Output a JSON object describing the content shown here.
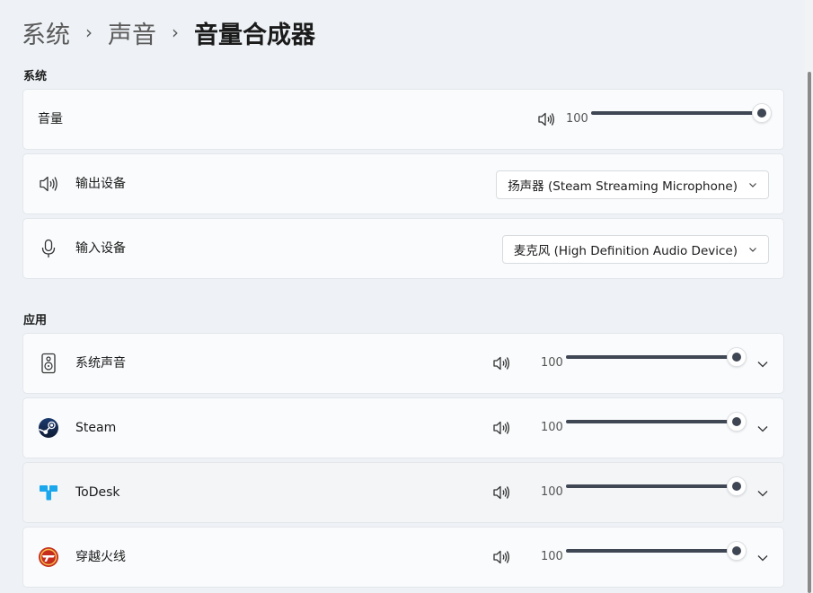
{
  "breadcrumb": {
    "items": [
      "系统",
      "声音"
    ],
    "separator": "›",
    "current": "音量合成器"
  },
  "system_section": {
    "label": "系统",
    "volume": {
      "label": "音量",
      "value": "100",
      "level": 1.0
    },
    "output": {
      "label": "输出设备",
      "selected": "扬声器 (Steam Streaming Microphone)"
    },
    "input": {
      "label": "输入设备",
      "selected": "麦克风 (High Definition Audio Device)"
    }
  },
  "apps_section": {
    "label": "应用",
    "apps": [
      {
        "name": "系统声音",
        "value": "100",
        "level": 1.0,
        "icon": "system-sounds-icon"
      },
      {
        "name": "Steam",
        "value": "100",
        "level": 1.0,
        "icon": "steam-icon"
      },
      {
        "name": "ToDesk",
        "value": "100",
        "level": 1.0,
        "icon": "todesk-icon"
      },
      {
        "name": "穿越火线",
        "value": "100",
        "level": 1.0,
        "icon": "crossfire-icon"
      }
    ]
  },
  "colors": {
    "accent": "#3f4654",
    "background": "#eef2f6",
    "card": "#f9fbfc"
  }
}
